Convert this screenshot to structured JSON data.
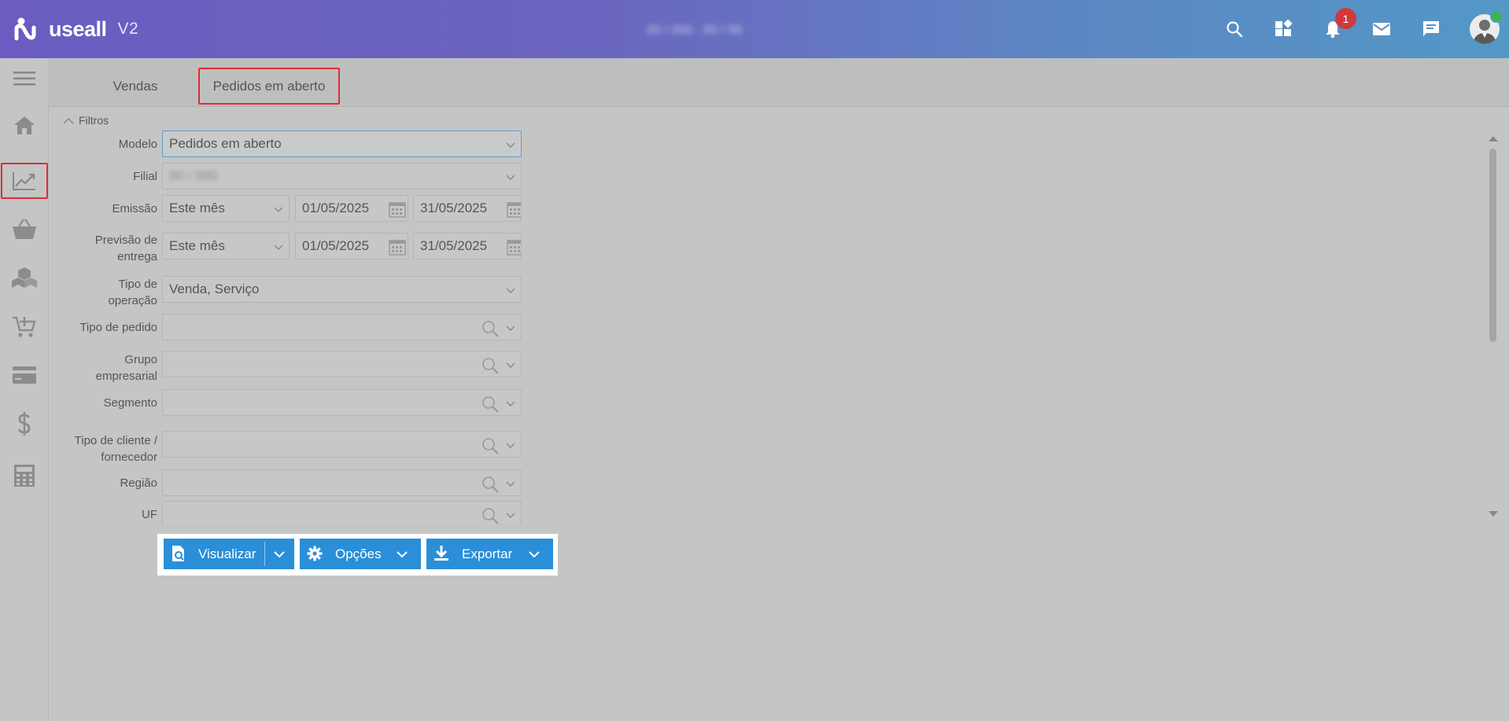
{
  "app": {
    "logo_text": "useall",
    "version": "V2",
    "header_blurred": "00 / 000 - 00 / 00",
    "notifications_count": "1"
  },
  "sidebar": {
    "items": [
      "menu-icon",
      "home-icon",
      "chart-line-icon",
      "basket-icon",
      "boxes-icon",
      "cart-add-icon",
      "credit-card-icon",
      "dollar-icon",
      "calculator-icon"
    ],
    "active": "chart-line-icon",
    "active_color": "#e22b33"
  },
  "tabs": [
    {
      "label": "Vendas"
    },
    {
      "label": "Pedidos em aberto",
      "active": true
    }
  ],
  "filters": {
    "section_label": "Filtros",
    "modelo": {
      "label": "Modelo",
      "value": "Pedidos em aberto"
    },
    "filial": {
      "label": "Filial",
      "value": "00 / 000"
    },
    "emissao": {
      "label": "Emissão",
      "period": "Este mês",
      "from": "01/05/2025",
      "to": "31/05/2025"
    },
    "previsao": {
      "label_line1": "Previsão de",
      "label_line2": "entrega",
      "period": "Este mês",
      "from": "01/05/2025",
      "to": "31/05/2025"
    },
    "tipo_operacao": {
      "label_line1": "Tipo de",
      "label_line2": "operação",
      "value": "Venda, Serviço"
    },
    "tipo_pedido": {
      "label": "Tipo de pedido",
      "value": ""
    },
    "grupo_empresarial": {
      "label_line1": "Grupo",
      "label_line2": "empresarial",
      "value": ""
    },
    "segmento": {
      "label": "Segmento",
      "value": ""
    },
    "tipo_cliente": {
      "label_line1": "Tipo de cliente /",
      "label_line2": "fornecedor",
      "value": ""
    },
    "regiao": {
      "label": "Região",
      "value": ""
    },
    "uf": {
      "label": "UF",
      "value": ""
    }
  },
  "actions": {
    "visualizar": "Visualizar",
    "opcoes": "Opções",
    "exportar": "Exportar",
    "button_color": "#2a8fd8"
  }
}
